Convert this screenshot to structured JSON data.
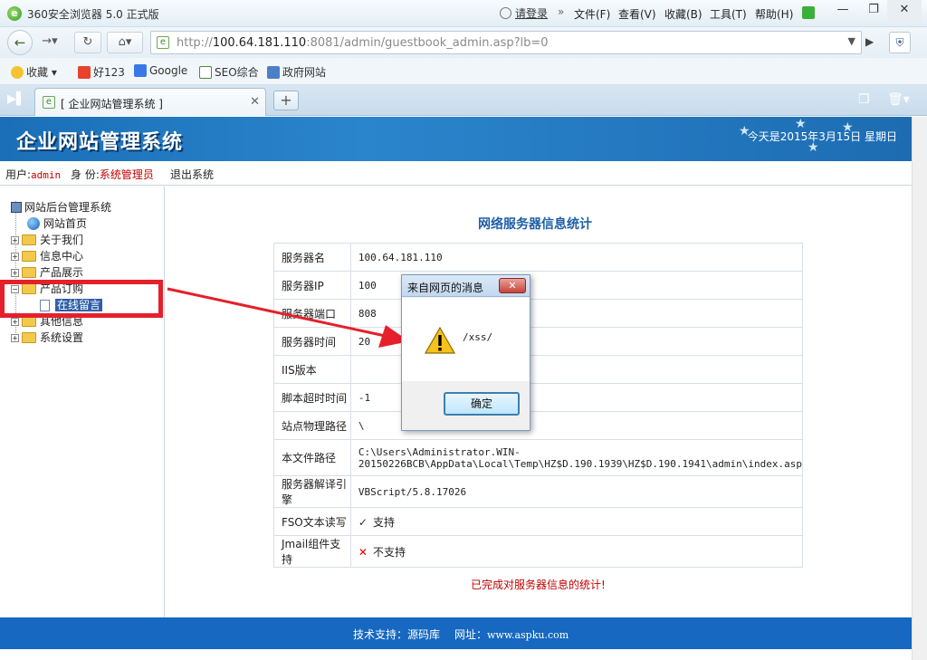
{
  "browser": {
    "app_title": "360安全浏览器 5.0 正式版",
    "login": "请登录",
    "menus": [
      "文件(F)",
      "查看(V)",
      "收藏(B)",
      "工具(T)",
      "帮助(H)"
    ],
    "url_prefix": "http://",
    "url_host": "100.64.181.110",
    "url_rest": ":8081/admin/guestbook_admin.asp?lb=0",
    "bookmarks": [
      "收藏",
      "好123",
      "Google",
      "SEO综合",
      "政府网站"
    ],
    "tab_title": "[ 企业网站管理系统 ]"
  },
  "header": {
    "site_title": "企业网站管理系统",
    "date_text": "今天是2015年3月15日 星期日"
  },
  "userbar": {
    "user_label": "用户:",
    "user_value": "admin",
    "role_label": "身 份:",
    "role_value": "系统管理员",
    "logout": "退出系统"
  },
  "tree": {
    "root": "网站后台管理系统",
    "items": [
      "网站首页",
      "关于我们",
      "信息中心",
      "产品展示",
      "产品订购",
      "在线留言",
      "其他信息",
      "系统设置"
    ]
  },
  "main": {
    "title": "网络服务器信息统计",
    "rows": [
      {
        "key": "服务器名",
        "value": "100.64.181.110"
      },
      {
        "key": "服务器IP",
        "value": "100"
      },
      {
        "key": "服务器端口",
        "value": "808"
      },
      {
        "key": "服务器时间",
        "value": "20"
      },
      {
        "key": "IIS版本",
        "value": ""
      },
      {
        "key": "脚本超时时间",
        "value": "-1"
      },
      {
        "key": "站点物理路径",
        "value": "\\"
      },
      {
        "key": "本文件路径",
        "value": "C:\\Users\\Administrator.WIN-20150226BCB\\AppData\\Local\\Temp\\HZ$D.190.1939\\HZ$D.190.1941\\admin\\index.asp"
      },
      {
        "key": "服务器解译引擎",
        "value": "VBScript/5.8.17026"
      },
      {
        "key": "FSO文本读写",
        "value": "支持"
      },
      {
        "key": "Jmail组件支持",
        "value": "不支持"
      }
    ],
    "done_text": "已完成对服务器信息的统计!"
  },
  "footer": {
    "support": "技术支持：源码库",
    "site_label": "网址：",
    "site_url": "www.aspku.com"
  },
  "dialog": {
    "title": "来自网页的消息",
    "message": "/xss/",
    "ok": "确定"
  }
}
